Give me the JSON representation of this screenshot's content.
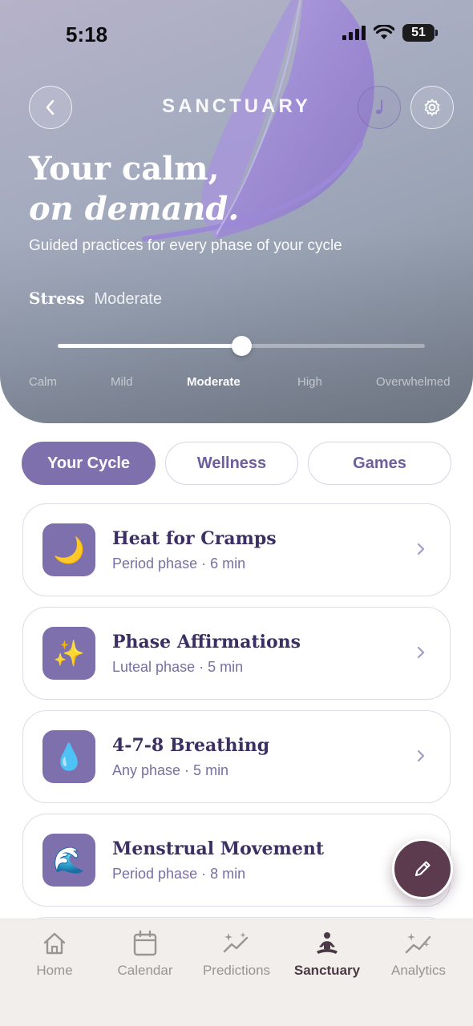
{
  "status_bar": {
    "time": "5:18",
    "battery": "51"
  },
  "header": {
    "title": "SANCTUARY",
    "back_icon": "chevron-left-icon",
    "music_icon": "music-note-icon",
    "settings_icon": "gear-icon"
  },
  "hero": {
    "headline_line1": "Your calm,",
    "headline_line2": "on demand.",
    "subtitle": "Guided practices for every phase of your cycle"
  },
  "stress": {
    "label": "Stress",
    "value": "Moderate",
    "level": 0.5,
    "levels": [
      "Calm",
      "Mild",
      "Moderate",
      "High",
      "Overwhelmed"
    ],
    "active_index": 2
  },
  "tabs": [
    {
      "label": "Your Cycle",
      "active": true
    },
    {
      "label": "Wellness",
      "active": false
    },
    {
      "label": "Games",
      "active": false
    }
  ],
  "practices": [
    {
      "icon": "crescent-moon-icon",
      "emoji": "🌙",
      "title": "Heat for Cramps",
      "subtitle": "Period phase · 6 min"
    },
    {
      "icon": "sparkles-icon",
      "emoji": "✨",
      "title": "Phase Affirmations",
      "subtitle": "Luteal phase · 5 min"
    },
    {
      "icon": "droplet-icon",
      "emoji": "💧",
      "title": "4-7-8 Breathing",
      "subtitle": "Any phase · 5 min"
    },
    {
      "icon": "wave-icon",
      "emoji": "🌊",
      "title": "Menstrual Movement",
      "subtitle": "Period phase · 8 min"
    }
  ],
  "fab": {
    "icon": "pencil-icon"
  },
  "nav": [
    {
      "label": "Home",
      "icon": "home-icon",
      "active": false
    },
    {
      "label": "Calendar",
      "icon": "calendar-icon",
      "active": false
    },
    {
      "label": "Predictions",
      "icon": "sparkle-trend-icon",
      "active": false
    },
    {
      "label": "Sanctuary",
      "icon": "meditation-icon",
      "active": true
    },
    {
      "label": "Analytics",
      "icon": "analytics-icon",
      "active": false
    }
  ],
  "colors": {
    "accent": "#7e6fad",
    "fab": "#5c3b4f",
    "title_text": "#3b2f63",
    "nav_active": "#4a3a45",
    "nav_inactive": "#9a9492"
  }
}
